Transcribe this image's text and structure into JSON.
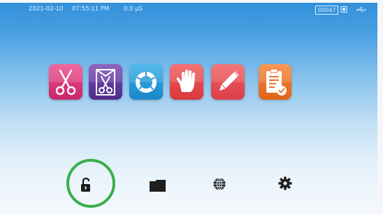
{
  "status_bar": {
    "date": "2021-02-10",
    "time": "07:55:11 PM",
    "dose": "0.0 µS",
    "counter": "00047",
    "icons": [
      "sd-card-icon",
      "usb-icon"
    ]
  },
  "apps": [
    {
      "name": "scissors-app",
      "icon": "scissors-icon",
      "color": "#d8357a"
    },
    {
      "name": "sterile-pack-app",
      "icon": "scissors-in-pouch-icon",
      "color": "#603a9e"
    },
    {
      "name": "cycle-app",
      "icon": "ring-icon",
      "color": "#279ad8"
    },
    {
      "name": "glove-app",
      "icon": "glove-icon",
      "color": "#e44a4d"
    },
    {
      "name": "edit-app",
      "icon": "pencil-icon",
      "color": "#e44f55"
    },
    {
      "name": "report-app",
      "icon": "clipboard-check-icon",
      "color": "#ec7328"
    }
  ],
  "dock": {
    "items": [
      "lock-open-icon",
      "folder-icon",
      "globe-icon",
      "gear-icon"
    ],
    "highlight_color": "#3cae4c"
  }
}
